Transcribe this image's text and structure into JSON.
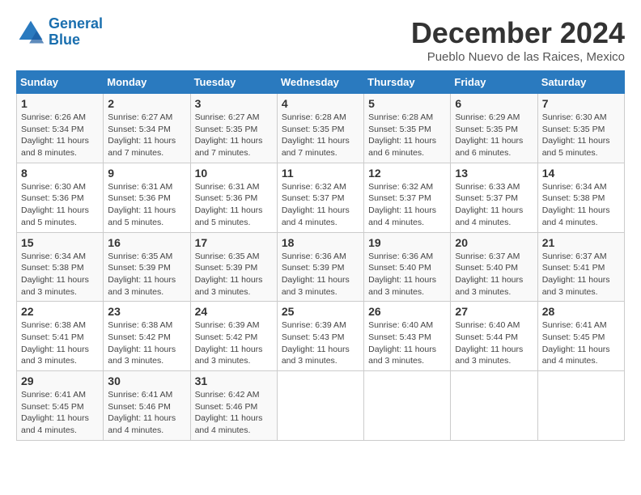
{
  "header": {
    "logo_line1": "General",
    "logo_line2": "Blue",
    "month": "December 2024",
    "location": "Pueblo Nuevo de las Raices, Mexico"
  },
  "days_of_week": [
    "Sunday",
    "Monday",
    "Tuesday",
    "Wednesday",
    "Thursday",
    "Friday",
    "Saturday"
  ],
  "weeks": [
    [
      {
        "num": "1",
        "rise": "6:26 AM",
        "set": "5:34 PM",
        "daylight": "11 hours and 8 minutes."
      },
      {
        "num": "2",
        "rise": "6:27 AM",
        "set": "5:34 PM",
        "daylight": "11 hours and 7 minutes."
      },
      {
        "num": "3",
        "rise": "6:27 AM",
        "set": "5:35 PM",
        "daylight": "11 hours and 7 minutes."
      },
      {
        "num": "4",
        "rise": "6:28 AM",
        "set": "5:35 PM",
        "daylight": "11 hours and 7 minutes."
      },
      {
        "num": "5",
        "rise": "6:28 AM",
        "set": "5:35 PM",
        "daylight": "11 hours and 6 minutes."
      },
      {
        "num": "6",
        "rise": "6:29 AM",
        "set": "5:35 PM",
        "daylight": "11 hours and 6 minutes."
      },
      {
        "num": "7",
        "rise": "6:30 AM",
        "set": "5:35 PM",
        "daylight": "11 hours and 5 minutes."
      }
    ],
    [
      {
        "num": "8",
        "rise": "6:30 AM",
        "set": "5:36 PM",
        "daylight": "11 hours and 5 minutes."
      },
      {
        "num": "9",
        "rise": "6:31 AM",
        "set": "5:36 PM",
        "daylight": "11 hours and 5 minutes."
      },
      {
        "num": "10",
        "rise": "6:31 AM",
        "set": "5:36 PM",
        "daylight": "11 hours and 5 minutes."
      },
      {
        "num": "11",
        "rise": "6:32 AM",
        "set": "5:37 PM",
        "daylight": "11 hours and 4 minutes."
      },
      {
        "num": "12",
        "rise": "6:32 AM",
        "set": "5:37 PM",
        "daylight": "11 hours and 4 minutes."
      },
      {
        "num": "13",
        "rise": "6:33 AM",
        "set": "5:37 PM",
        "daylight": "11 hours and 4 minutes."
      },
      {
        "num": "14",
        "rise": "6:34 AM",
        "set": "5:38 PM",
        "daylight": "11 hours and 4 minutes."
      }
    ],
    [
      {
        "num": "15",
        "rise": "6:34 AM",
        "set": "5:38 PM",
        "daylight": "11 hours and 3 minutes."
      },
      {
        "num": "16",
        "rise": "6:35 AM",
        "set": "5:39 PM",
        "daylight": "11 hours and 3 minutes."
      },
      {
        "num": "17",
        "rise": "6:35 AM",
        "set": "5:39 PM",
        "daylight": "11 hours and 3 minutes."
      },
      {
        "num": "18",
        "rise": "6:36 AM",
        "set": "5:39 PM",
        "daylight": "11 hours and 3 minutes."
      },
      {
        "num": "19",
        "rise": "6:36 AM",
        "set": "5:40 PM",
        "daylight": "11 hours and 3 minutes."
      },
      {
        "num": "20",
        "rise": "6:37 AM",
        "set": "5:40 PM",
        "daylight": "11 hours and 3 minutes."
      },
      {
        "num": "21",
        "rise": "6:37 AM",
        "set": "5:41 PM",
        "daylight": "11 hours and 3 minutes."
      }
    ],
    [
      {
        "num": "22",
        "rise": "6:38 AM",
        "set": "5:41 PM",
        "daylight": "11 hours and 3 minutes."
      },
      {
        "num": "23",
        "rise": "6:38 AM",
        "set": "5:42 PM",
        "daylight": "11 hours and 3 minutes."
      },
      {
        "num": "24",
        "rise": "6:39 AM",
        "set": "5:42 PM",
        "daylight": "11 hours and 3 minutes."
      },
      {
        "num": "25",
        "rise": "6:39 AM",
        "set": "5:43 PM",
        "daylight": "11 hours and 3 minutes."
      },
      {
        "num": "26",
        "rise": "6:40 AM",
        "set": "5:43 PM",
        "daylight": "11 hours and 3 minutes."
      },
      {
        "num": "27",
        "rise": "6:40 AM",
        "set": "5:44 PM",
        "daylight": "11 hours and 3 minutes."
      },
      {
        "num": "28",
        "rise": "6:41 AM",
        "set": "5:45 PM",
        "daylight": "11 hours and 4 minutes."
      }
    ],
    [
      {
        "num": "29",
        "rise": "6:41 AM",
        "set": "5:45 PM",
        "daylight": "11 hours and 4 minutes."
      },
      {
        "num": "30",
        "rise": "6:41 AM",
        "set": "5:46 PM",
        "daylight": "11 hours and 4 minutes."
      },
      {
        "num": "31",
        "rise": "6:42 AM",
        "set": "5:46 PM",
        "daylight": "11 hours and 4 minutes."
      },
      null,
      null,
      null,
      null
    ]
  ]
}
